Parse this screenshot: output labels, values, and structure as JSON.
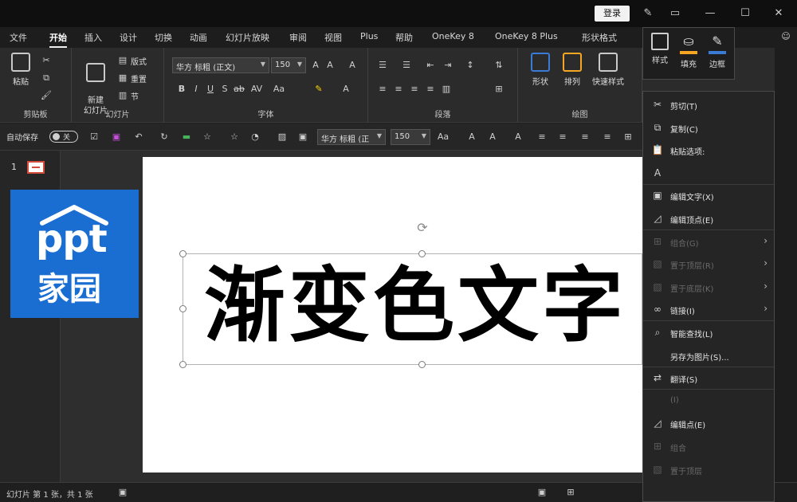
{
  "titlebar": {
    "login": "登录"
  },
  "tabs": [
    {
      "label": "文件"
    },
    {
      "label": "开始"
    },
    {
      "label": "插入"
    },
    {
      "label": "设计"
    },
    {
      "label": "切换"
    },
    {
      "label": "动画"
    },
    {
      "label": "幻灯片放映"
    },
    {
      "label": "审阅"
    },
    {
      "label": "视图"
    },
    {
      "label": "Plus"
    },
    {
      "label": "帮助"
    },
    {
      "label": "OneKey 8"
    },
    {
      "label": "OneKey 8 Plus"
    },
    {
      "label": "形状格式"
    }
  ],
  "ribbon": {
    "clipboard": {
      "label": "剪贴板",
      "paste": "粘贴"
    },
    "slides": {
      "label": "幻灯片",
      "new_slide": "新建\n幻灯片",
      "layout": "版式",
      "reset": "重置",
      "section": "节"
    },
    "font": {
      "label": "字体",
      "family": "华方 标粗 (正文)",
      "size": "150"
    },
    "paragraph": {
      "label": "段落"
    },
    "drawing": {
      "label": "绘图",
      "shape": "形状",
      "arrange": "排列",
      "quick_style": "快速样式"
    }
  },
  "qat": {
    "autosave": "自动保存",
    "toggle": "关",
    "font_family": "华方 标粗 (正",
    "font_size": "150"
  },
  "slides_panel": {
    "slide_number": "1"
  },
  "logo": {
    "line1": "ppt",
    "line2": "家园",
    "bg": "#1a6dd1"
  },
  "slide": {
    "title": "渐变色文字"
  },
  "status": {
    "text": "幻灯片 第 1 张，共 1 张"
  },
  "mini_toolbar": {
    "style": "样式",
    "fill": "填充",
    "border": "边框",
    "fill_color": "#f5a623",
    "border_color": "#3a7bd5"
  },
  "context_menu": [
    {
      "label": "剪切(T)",
      "icon": "scissors-icon",
      "disabled": false,
      "arrow": false
    },
    {
      "label": "复制(C)",
      "icon": "copy-icon",
      "disabled": false,
      "arrow": false
    },
    {
      "label": "粘贴选项:",
      "icon": "paste-icon",
      "disabled": false,
      "arrow": false
    },
    {
      "label": "",
      "icon": "paste-text-icon",
      "disabled": false,
      "arrow": false
    },
    {
      "label": "编辑文字(X)",
      "icon": "edit-text-icon",
      "disabled": false,
      "arrow": false
    },
    {
      "label": "编辑顶点(E)",
      "icon": "edit-points-icon",
      "disabled": false,
      "arrow": false
    },
    {
      "label": "组合(G)",
      "icon": "group-icon",
      "disabled": true,
      "arrow": true
    },
    {
      "label": "置于顶层(R)",
      "icon": "bring-front-icon",
      "disabled": true,
      "arrow": true
    },
    {
      "label": "置于底层(K)",
      "icon": "send-back-icon",
      "disabled": true,
      "arrow": true
    },
    {
      "label": "链接(I)",
      "icon": "link-icon",
      "disabled": false,
      "arrow": true
    },
    {
      "label": "智能查找(L)",
      "icon": "search-icon",
      "disabled": false,
      "arrow": false
    },
    {
      "label": "另存为图片(S)...",
      "icon": "",
      "disabled": false,
      "arrow": false
    },
    {
      "label": "翻译(S)",
      "icon": "translate-icon",
      "disabled": false,
      "arrow": false
    },
    {
      "label": "(I)",
      "icon": "",
      "disabled": true,
      "arrow": false
    },
    {
      "label": "编辑点(E)",
      "icon": "edit-points-icon",
      "disabled": false,
      "arrow": false
    },
    {
      "label": "组合",
      "icon": "group-icon",
      "disabled": true,
      "arrow": false
    },
    {
      "label": "置于顶层",
      "icon": "bring-front-icon",
      "disabled": true,
      "arrow": false
    }
  ]
}
